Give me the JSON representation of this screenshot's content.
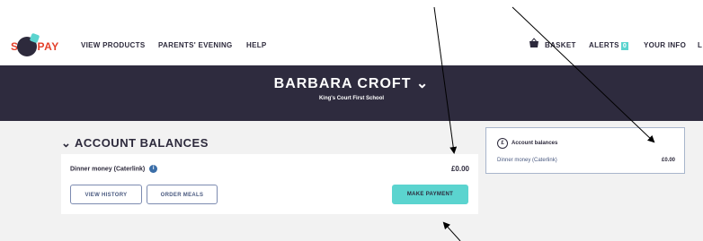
{
  "nav": {
    "logo_text": "SCOPAY",
    "links": [
      "VIEW PRODUCTS",
      "PARENTS' EVENING",
      "HELP"
    ],
    "basket": "BASKET",
    "alerts": "ALERTS",
    "alerts_count": "0",
    "your_info": "YOUR INFO",
    "truncated": "L"
  },
  "hero": {
    "name": "BARBARA CROFT",
    "school": "King's Court First School"
  },
  "account": {
    "section_title": "ACCOUNT BALANCES",
    "row_label": "Dinner money (Caterlink)",
    "row_amount": "£0.00",
    "view_history": "VIEW HISTORY",
    "order_meals": "ORDER MEALS",
    "make_payment": "MAKE PAYMENT"
  },
  "sidebar": {
    "title": "Account balances",
    "label": "Dinner money (Caterlink)",
    "amount": "£0.00"
  },
  "colors": {
    "brand_red": "#e4402a",
    "accent_teal": "#5bd4cf",
    "hero_bg": "#2e2b3e"
  }
}
